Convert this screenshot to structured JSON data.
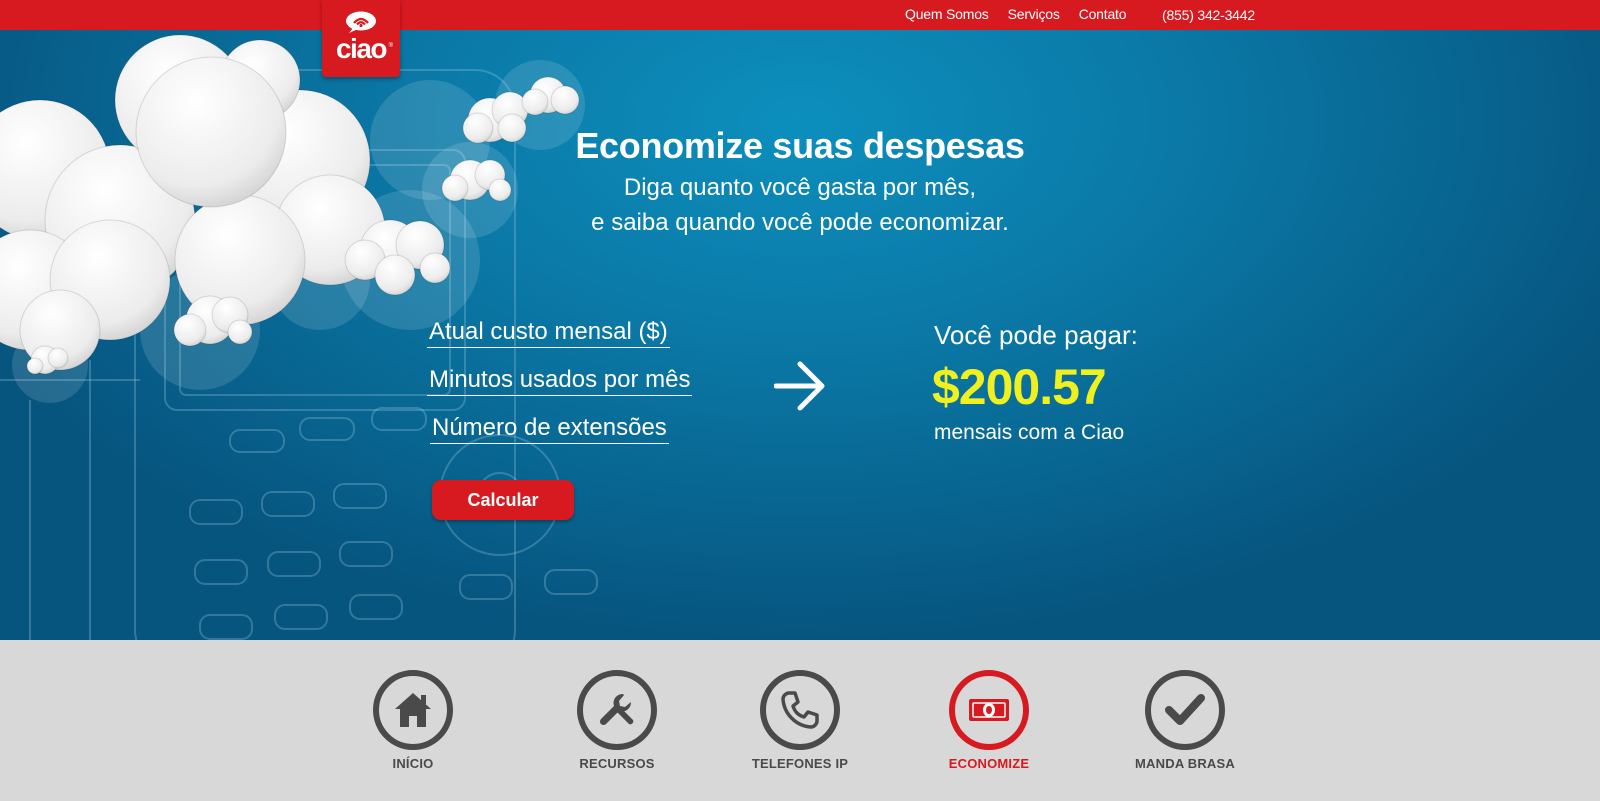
{
  "header": {
    "nav": [
      "Quem Somos",
      "Serviços",
      "Contato"
    ],
    "phone": "(855) 342-3442",
    "logo_text": "ciao",
    "logo_reg": "®"
  },
  "hero": {
    "title": "Economize suas despesas",
    "subtitle_line1": "Diga quanto você gasta por mês,",
    "subtitle_line2": "e saiba quando você pode economizar."
  },
  "calculator": {
    "fields": [
      "Atual custo mensal ($)",
      "Minutos usados por mês",
      "Número de extensões"
    ],
    "button": "Calcular",
    "arrow_icon": "arrow-right-icon"
  },
  "result": {
    "label": "Você pode pagar:",
    "value": "$200.57",
    "note": "mensais com a Ciao",
    "value_color": "#f0f01e"
  },
  "bottom_nav": [
    {
      "label": "INÍCIO",
      "icon": "home-icon",
      "active": false
    },
    {
      "label": "RECURSOS",
      "icon": "wrench-icon",
      "active": false
    },
    {
      "label": "TELEFONES IP",
      "icon": "phone-icon",
      "active": false
    },
    {
      "label": "ECONOMIZE",
      "icon": "money-icon",
      "active": true
    },
    {
      "label": "MANDA BRASA",
      "icon": "checkmark-icon",
      "active": false
    }
  ],
  "colors": {
    "brand_red": "#d71920",
    "hero_blue": "#0b7aa8",
    "nav_gray": "#4a4a4a",
    "footer_bg": "#d9d8d9"
  }
}
